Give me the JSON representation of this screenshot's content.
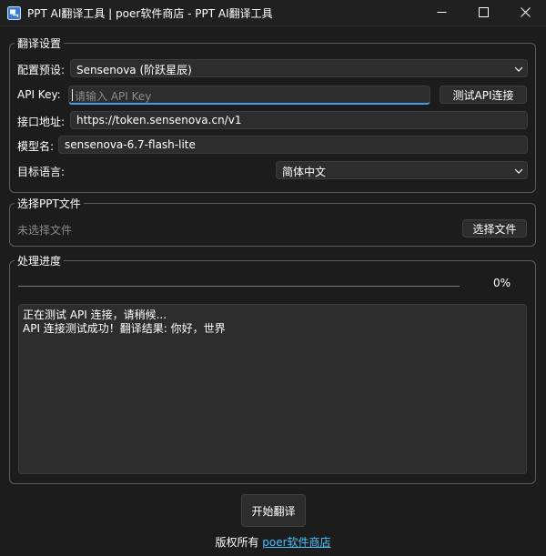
{
  "window": {
    "title": "PPT AI翻译工具 | poer软件商店 - PPT AI翻译工具"
  },
  "translation_settings": {
    "group_title": "翻译设置",
    "preset": {
      "label": "配置预设:",
      "value": "Sensenova (阶跃星辰)"
    },
    "api_key": {
      "label": "API Key:",
      "value": "",
      "placeholder": "请输入 API Key",
      "test_button": "测试API连接"
    },
    "endpoint": {
      "label": "接口地址:",
      "value": "https://token.sensenova.cn/v1"
    },
    "model": {
      "label": "模型名:",
      "value": "sensenova-6.7-flash-lite"
    },
    "target_language": {
      "label": "目标语言:",
      "value": "简体中文"
    }
  },
  "file_select": {
    "group_title": "选择PPT文件",
    "status": "未选择文件",
    "button": "选择文件"
  },
  "progress": {
    "group_title": "处理进度",
    "percent_text": "0%",
    "value": 0,
    "log": [
      "正在测试 API 连接，请稍候...",
      "API 连接测试成功！翻译结果: 你好，世界"
    ]
  },
  "actions": {
    "start_button": "开始翻译"
  },
  "footer": {
    "copyright_prefix": "版权所有 ",
    "link_text": "poer软件商店"
  },
  "colors": {
    "background": "#1c1c1c",
    "input_bg": "#2d2d2d",
    "accent": "#4c9be8",
    "link": "#4cc2ff"
  },
  "icons": {
    "app": "app-window-icon",
    "minimize": "minimize-icon",
    "maximize": "maximize-icon",
    "close": "close-icon",
    "dropdown": "chevron-down-icon"
  }
}
